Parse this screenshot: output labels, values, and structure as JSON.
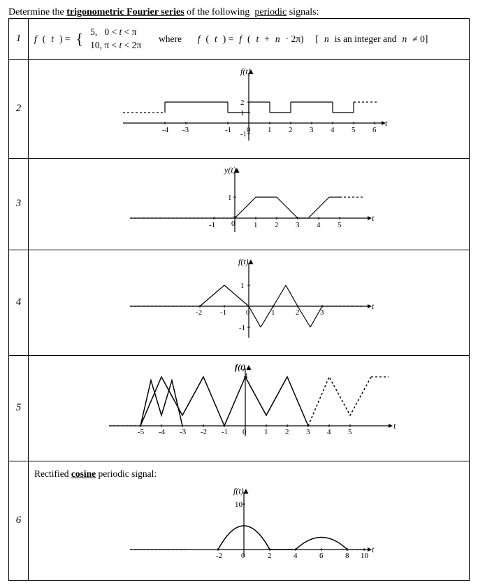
{
  "header": {
    "text": "Determine the",
    "bold_underline": "trigonometric Fourier series",
    "text2": "of the following",
    "underline2": "periodic",
    "text3": "signals:"
  },
  "rows": [
    {
      "num": "1"
    },
    {
      "num": "2"
    },
    {
      "num": "3"
    },
    {
      "num": "4"
    },
    {
      "num": "5"
    },
    {
      "num": "6"
    }
  ]
}
